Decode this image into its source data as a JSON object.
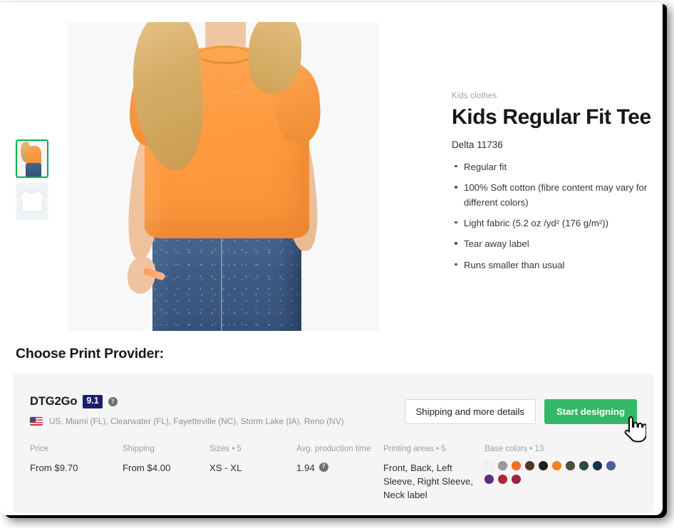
{
  "product": {
    "eyebrow": "Kids clothes",
    "title": "Kids Regular Fit Tee",
    "sku": "Delta 11736",
    "features": [
      "Regular fit",
      "100% Soft cotton (fibre content may vary for different colors)",
      "Light fabric (5.2 oz /yd² (176 g/m²))",
      "Tear away label",
      "Runs smaller than usual"
    ],
    "thumbnails": [
      {
        "name": "thumbnail-front-model",
        "selected": true
      },
      {
        "name": "thumbnail-flat-white-tee",
        "selected": false
      }
    ]
  },
  "section": {
    "heading": "Choose Print Provider:"
  },
  "provider": {
    "name": "DTG2Go",
    "score": "9.1",
    "score_help_icon": "question-mark-icon",
    "flag_icon": "us-flag-icon",
    "locations": "US, Miami (FL), Clearwater (FL), Fayetteville (NC), Storm Lake (IA), Reno (NV)",
    "buttons": {
      "details": "Shipping and more details",
      "start": "Start designing"
    },
    "specs": [
      {
        "label": "Price",
        "value": "From $9.70",
        "help": false
      },
      {
        "label": "Shipping",
        "value": "From $4.00",
        "help": false
      },
      {
        "label": "Sizes • 5",
        "value": "XS - XL",
        "help": false
      },
      {
        "label": "Avg. production time",
        "value": "1.94",
        "help": true
      },
      {
        "label": "Printing areas • 5",
        "value": "Front, Back, Left Sleeve, Right Sleeve, Neck label",
        "help": false
      }
    ],
    "base_colors_label": "Base colors • 13",
    "base_colors": [
      "#f2f2f0",
      "#9a9a9a",
      "#f4701f",
      "#5a3229",
      "#201f1d",
      "#f58220",
      "#4a5138",
      "#2b4b3c",
      "#143050",
      "#4d5d9b",
      "#5c2d82",
      "#b3253c",
      "#a31f3f"
    ]
  },
  "theme": {
    "accent_green": "#33b867",
    "badge_navy": "#1d1d6e",
    "card_bg": "#f5f5f5",
    "muted_text": "#9aa0a6"
  },
  "cursor": {
    "icon": "pointing-hand-cursor"
  }
}
